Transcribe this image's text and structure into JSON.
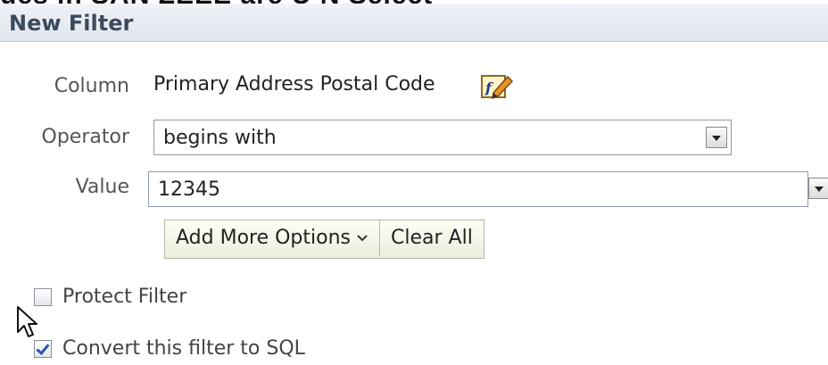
{
  "top_cut_text": "ues in SAN ZEEE are U    N  Select",
  "dialog": {
    "title": "New Filter"
  },
  "form": {
    "column_label": "Column",
    "column_value": "Primary Address Postal Code",
    "operator_label": "Operator",
    "operator_value": "begins with",
    "value_label": "Value",
    "value_value": "12345"
  },
  "buttons": {
    "add_more_options": "Add More Options",
    "clear_all": "Clear All"
  },
  "checkboxes": {
    "protect_filter": {
      "label": "Protect Filter",
      "checked": false
    },
    "convert_sql": {
      "label": "Convert this filter to SQL",
      "checked": true
    }
  },
  "icons": {
    "edit_formula": "fx-edit-icon",
    "dropdown": "chevron-down-icon",
    "cursor": "mouse-pointer-icon"
  },
  "colors": {
    "header_bg": "#e4e9f0",
    "title": "#3c4a5d",
    "button_bg": "#f5f5e8"
  }
}
